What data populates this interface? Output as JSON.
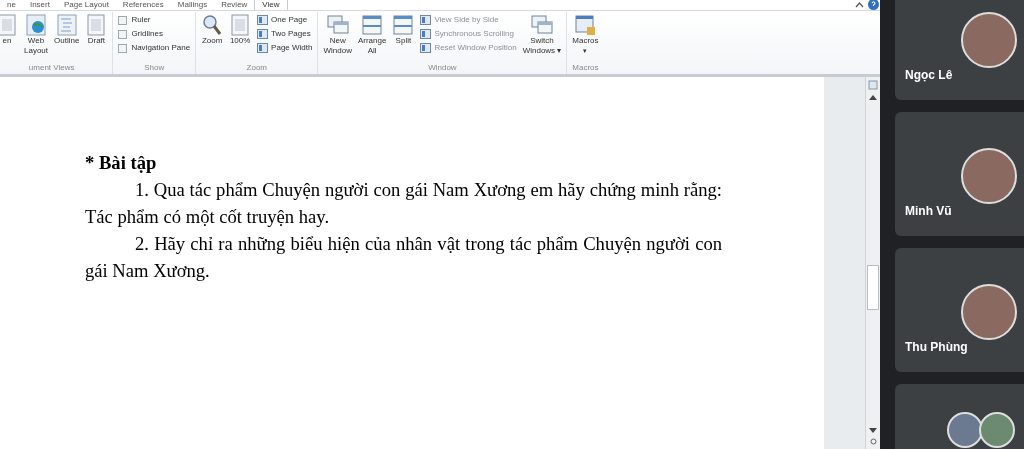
{
  "ribbon": {
    "tabs": [
      {
        "label": "ne",
        "selected": false
      },
      {
        "label": "Insert",
        "selected": false
      },
      {
        "label": "Page Layout",
        "selected": false
      },
      {
        "label": "References",
        "selected": false
      },
      {
        "label": "Mailings",
        "selected": false
      },
      {
        "label": "Review",
        "selected": false
      },
      {
        "label": "View",
        "selected": true
      }
    ],
    "groups": [
      {
        "label": "ument Views",
        "items": [
          {
            "kind": "large",
            "lines": [
              "en"
            ]
          },
          {
            "kind": "large",
            "lines": [
              "Web",
              "Layout"
            ]
          },
          {
            "kind": "large",
            "lines": [
              "Outline"
            ]
          },
          {
            "kind": "large",
            "lines": [
              "Draft"
            ]
          }
        ]
      },
      {
        "label": "Show",
        "items": [
          {
            "kind": "check",
            "label": "Ruler",
            "checked": false
          },
          {
            "kind": "check",
            "label": "Gridlines",
            "checked": false
          },
          {
            "kind": "check",
            "label": "Navigation Pane",
            "checked": false
          }
        ]
      },
      {
        "label": "Zoom",
        "items": [
          {
            "kind": "large",
            "lines": [
              "Zoom"
            ]
          },
          {
            "kind": "large",
            "lines": [
              "100%"
            ]
          },
          {
            "kind": "small",
            "label": "One Page",
            "disabled": false
          },
          {
            "kind": "small",
            "label": "Two Pages",
            "disabled": false
          },
          {
            "kind": "small",
            "label": "Page Width",
            "disabled": false
          }
        ]
      },
      {
        "label": "Window",
        "items": [
          {
            "kind": "large",
            "lines": [
              "New",
              "Window"
            ]
          },
          {
            "kind": "large",
            "lines": [
              "Arrange",
              "All"
            ]
          },
          {
            "kind": "large",
            "lines": [
              "Split"
            ]
          },
          {
            "kind": "small",
            "label": "View Side by Side",
            "disabled": true
          },
          {
            "kind": "small",
            "label": "Synchronous Scrolling",
            "disabled": true
          },
          {
            "kind": "small",
            "label": "Reset Window Position",
            "disabled": true
          },
          {
            "kind": "large",
            "lines": [
              "Switch",
              "Windows"
            ],
            "caret": "▾"
          }
        ]
      },
      {
        "label": "Macros",
        "items": [
          {
            "kind": "large",
            "lines": [
              "Macros"
            ],
            "caret": "▾"
          }
        ]
      }
    ]
  },
  "document": {
    "heading": "* Bài tập",
    "paragraphs": [
      "1. Qua tác phẩm Chuyện người con gái Nam Xương em hãy chứng minh rằng: Tác phẩm có một cốt truyện hay.",
      "2. Hãy chỉ ra những biểu hiện của nhân vật trong tác phẩm Chuyện người con gái Nam Xương."
    ]
  },
  "participants": [
    {
      "kind": "single",
      "name": "Ngọc Lê"
    },
    {
      "kind": "single",
      "name": "Minh Vũ"
    },
    {
      "kind": "single",
      "name": "Thu Phùng"
    },
    {
      "kind": "pair"
    }
  ]
}
